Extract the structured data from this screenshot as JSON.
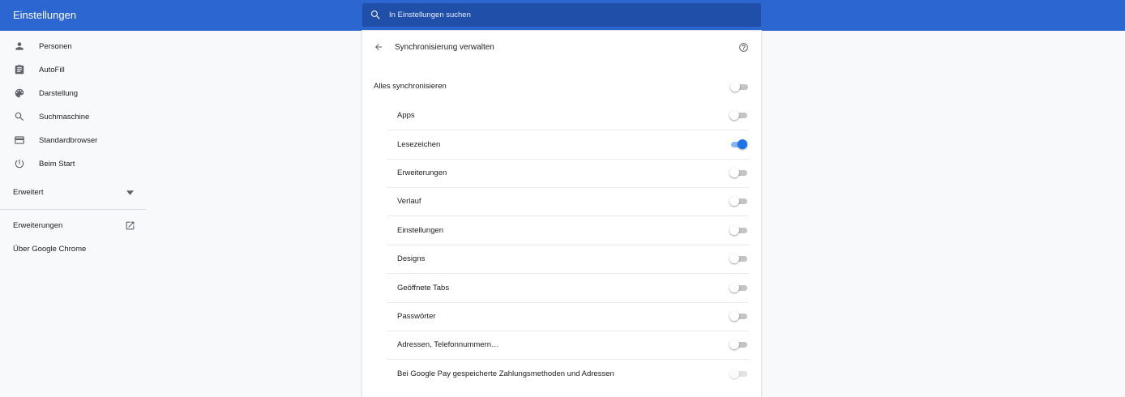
{
  "header": {
    "title": "Einstellungen",
    "search_placeholder": "In Einstellungen suchen"
  },
  "sidebar": {
    "items": [
      {
        "label": "Personen",
        "icon": "person-icon"
      },
      {
        "label": "AutoFill",
        "icon": "clipboard-icon"
      },
      {
        "label": "Darstellung",
        "icon": "palette-icon"
      },
      {
        "label": "Suchmaschine",
        "icon": "search-icon"
      },
      {
        "label": "Standardbrowser",
        "icon": "browser-window-icon"
      },
      {
        "label": "Beim Start",
        "icon": "power-icon"
      }
    ],
    "advanced_label": "Erweitert",
    "extensions_label": "Erweiterungen",
    "about_label": "Über Google Chrome"
  },
  "card": {
    "title": "Synchronisierung verwalten",
    "sync_all": {
      "label": "Alles synchronisieren",
      "on": false
    },
    "items": [
      {
        "label": "Apps",
        "on": false
      },
      {
        "label": "Lesezeichen",
        "on": true
      },
      {
        "label": "Erweiterungen",
        "on": false
      },
      {
        "label": "Verlauf",
        "on": false
      },
      {
        "label": "Einstellungen",
        "on": false
      },
      {
        "label": "Designs",
        "on": false
      },
      {
        "label": "Geöffnete Tabs",
        "on": false
      },
      {
        "label": "Passwörter",
        "on": false
      },
      {
        "label": "Adressen, Telefonnummern…",
        "on": false
      },
      {
        "label": "Bei Google Pay gespeicherte Zahlungsmethoden und Adressen",
        "on": false,
        "disabled": true
      }
    ]
  },
  "colors": {
    "header_blue": "#2b66d1",
    "search_bg": "#1f4fa8",
    "toggle_on": "#1a73e8"
  }
}
